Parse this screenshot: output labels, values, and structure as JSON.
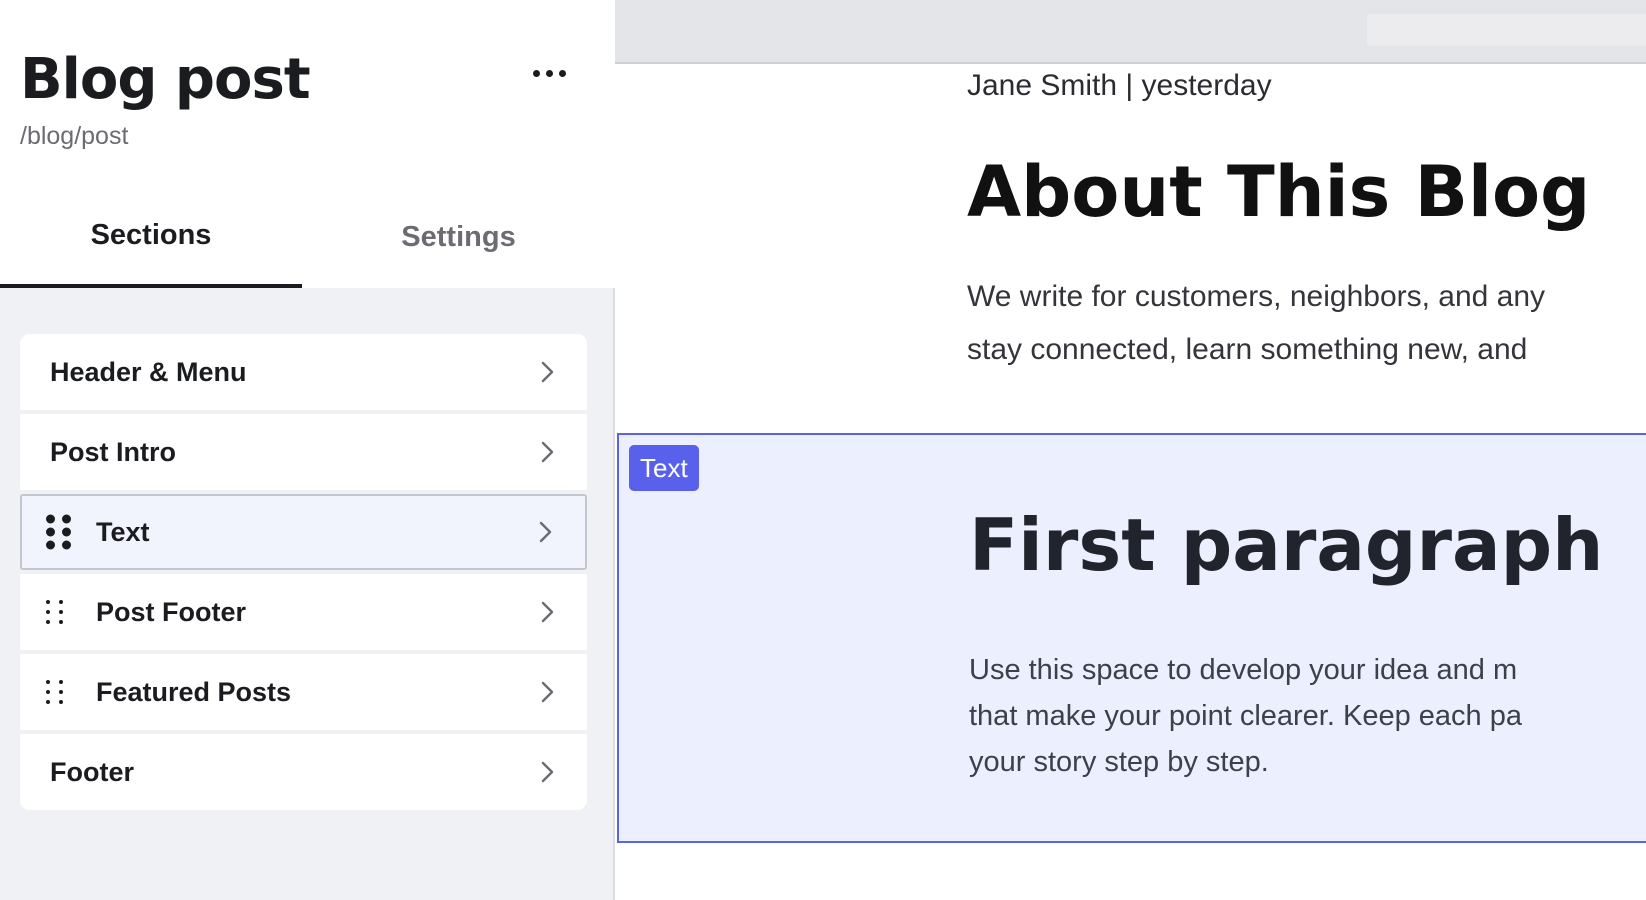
{
  "editor": {
    "page_title": "Blog post",
    "page_path": "/blog/post",
    "more_icon": "more-horizontal-icon",
    "tabs": [
      {
        "label": "Sections",
        "active": true
      },
      {
        "label": "Settings",
        "active": false
      }
    ],
    "sections": [
      {
        "label": "Header & Menu",
        "draggable": false,
        "selected": false
      },
      {
        "label": "Post Intro",
        "draggable": false,
        "selected": false
      },
      {
        "label": "Text",
        "draggable": true,
        "selected": true
      },
      {
        "label": "Post Footer",
        "draggable": true,
        "selected": false
      },
      {
        "label": "Featured Posts",
        "draggable": true,
        "selected": false
      },
      {
        "label": "Footer",
        "draggable": false,
        "selected": false
      }
    ],
    "chevron_icon": "chevron-right-icon",
    "drag_icon": "drag-handle-icon"
  },
  "preview": {
    "byline": "Jane Smith | yesterday",
    "post_title": "About This Blog",
    "intro_lines": [
      "We write for customers, neighbors, and any",
      "stay connected, learn something new, and"
    ],
    "selected_section": {
      "tag": "Text",
      "heading": "First paragraph",
      "body_lines": [
        "Use this space to develop your idea and m",
        "that make your point clearer. Keep each pa",
        "your story step by step."
      ]
    }
  },
  "colors": {
    "accent": "#5960ec",
    "selection_fill": "#eceffd",
    "selection_border": "#5b62e6",
    "panel_bg": "#f0f1f5",
    "text_primary": "#1b1c1f",
    "text_muted": "#6a6c72"
  }
}
